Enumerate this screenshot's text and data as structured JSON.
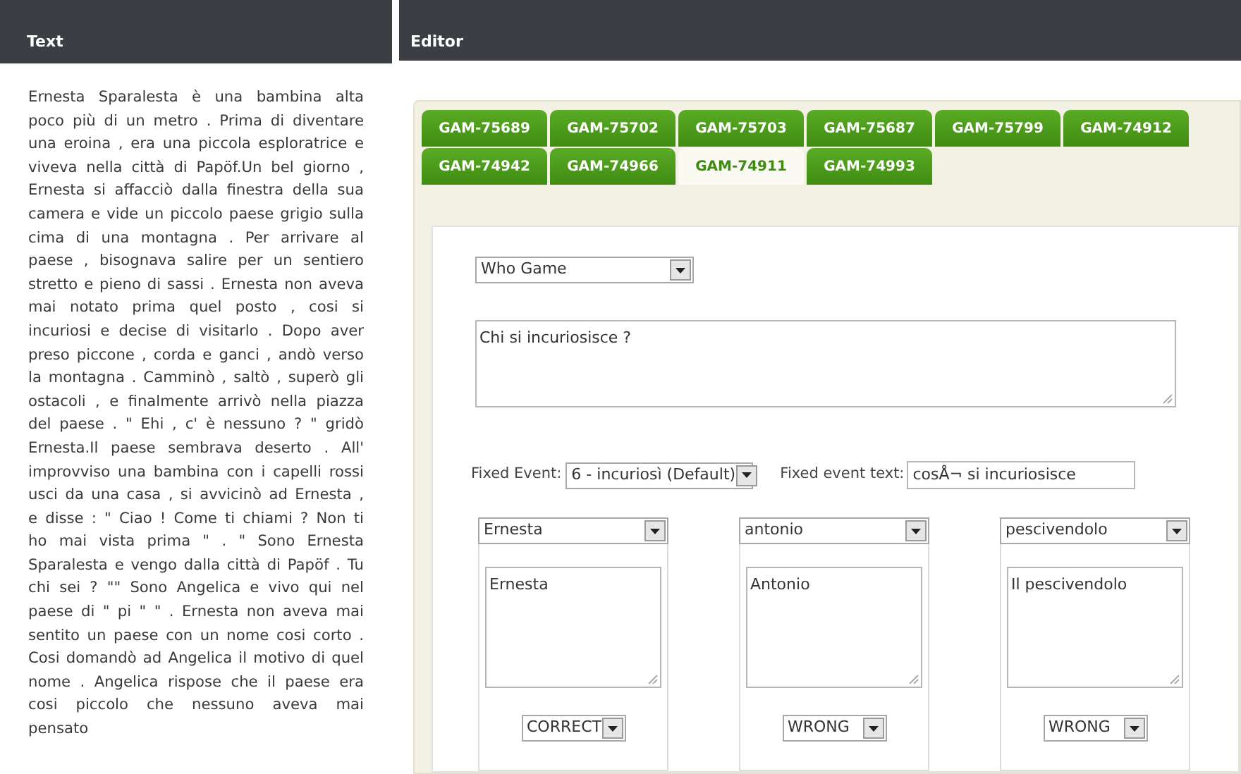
{
  "text_panel": {
    "title": "Text",
    "body": "Ernesta Sparalesta è una bambina alta poco più di un metro . Prima di diventare una eroina , era una piccola esploratrice e viveva nella città di Papöf.Un bel giorno , Ernesta si affacciò dalla finestra della sua camera e vide un piccolo paese grigio sulla cima di una montagna . Per arrivare al paese , bisognava salire per un sentiero stretto e pieno di sassi . Ernesta non aveva mai notato prima quel posto , cosi si incuriosi e decise di visitarlo . Dopo aver preso piccone , corda e ganci , andò verso la montagna . Camminò , saltò , superò gli ostacoli , e finalmente arrivò nella piazza del paese . \" Ehi , c' è nessuno ? \" gridò Ernesta.Il paese sembrava deserto . All' improvviso una bambina con i capelli rossi usci da una casa , si avvicinò ad Ernesta , e disse : \" Ciao ! Come ti chiami ? Non ti ho mai vista prima \" . \" Sono Ernesta Sparalesta e vengo dalla città di Papöf . Tu chi sei ? \"\" Sono Angelica e vivo qui nel paese di \" pi \" \" . Ernesta non aveva mai sentito un paese con un nome cosi corto . Cosi domandò ad Angelica il motivo di quel nome . Angelica rispose che il paese era cosi piccolo che nessuno aveva mai pensato"
  },
  "editor": {
    "title": "Editor",
    "tabs": [
      {
        "label": "GAM-75689",
        "selected": false
      },
      {
        "label": "GAM-75702",
        "selected": false
      },
      {
        "label": "GAM-75703",
        "selected": false
      },
      {
        "label": "GAM-75687",
        "selected": false
      },
      {
        "label": "GAM-75799",
        "selected": false
      },
      {
        "label": "GAM-74912",
        "selected": false
      },
      {
        "label": "GAM-74942",
        "selected": false
      },
      {
        "label": "GAM-74966",
        "selected": false
      },
      {
        "label": "GAM-74911",
        "selected": true
      },
      {
        "label": "GAM-74993",
        "selected": false
      }
    ],
    "game_type": "Who Game",
    "question": "Chi  si incuriosisce ?",
    "fixed_event": {
      "label": "Fixed Event:",
      "value": "6 - incuriosì (Default)"
    },
    "fixed_event_text": {
      "label": "Fixed event text:",
      "value": "cosÅ¬ si incuriosisce"
    },
    "answers": [
      {
        "character": "Ernesta",
        "text": "Ernesta",
        "verdict": "CORRECT"
      },
      {
        "character": "antonio",
        "text": "Antonio",
        "verdict": "WRONG"
      },
      {
        "character": "pescivendolo",
        "text": "Il pescivendolo",
        "verdict": "WRONG"
      }
    ]
  }
}
